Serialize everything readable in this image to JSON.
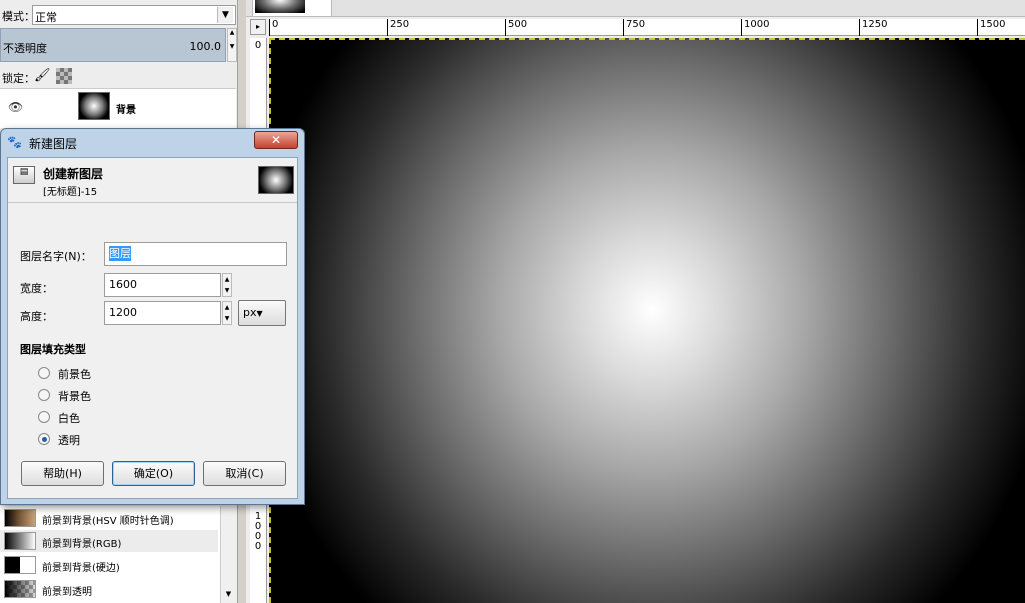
{
  "layers_panel": {
    "mode_label": "模式：",
    "mode_value": "正常",
    "opacity_label": "不透明度",
    "opacity_value": "100.0",
    "lock_label": "锁定：",
    "layers": [
      {
        "name": "背景",
        "visible": true
      }
    ]
  },
  "gradients": [
    {
      "label": "前景到背景(HSV 顺时针色调)"
    },
    {
      "label": "前景到背景(RGB)"
    },
    {
      "label": "前景到背景(硬边)"
    },
    {
      "label": "前景到透明"
    }
  ],
  "ruler": {
    "h_ticks": [
      "0",
      "250",
      "500",
      "750",
      "1000",
      "1250",
      "1500"
    ],
    "v_top": "0",
    "v_bottom": [
      "1",
      "0",
      "0",
      "0"
    ]
  },
  "dialog": {
    "title": "新建图层",
    "header_title": "创建新图层",
    "header_subtitle": "[无标题]-15",
    "layer_name_label": "图层名字(N)：",
    "layer_name_value": "图层",
    "width_label": "宽度：",
    "width_value": "1600",
    "height_label": "高度：",
    "height_value": "1200",
    "unit": "px",
    "fill_section_title": "图层填充类型",
    "fill_options": [
      {
        "label": "前景色",
        "selected": false
      },
      {
        "label": "背景色",
        "selected": false
      },
      {
        "label": "白色",
        "selected": false
      },
      {
        "label": "透明",
        "selected": true
      }
    ],
    "help_button": "帮助(H)",
    "ok_button": "确定(O)",
    "cancel_button": "取消(C)"
  }
}
